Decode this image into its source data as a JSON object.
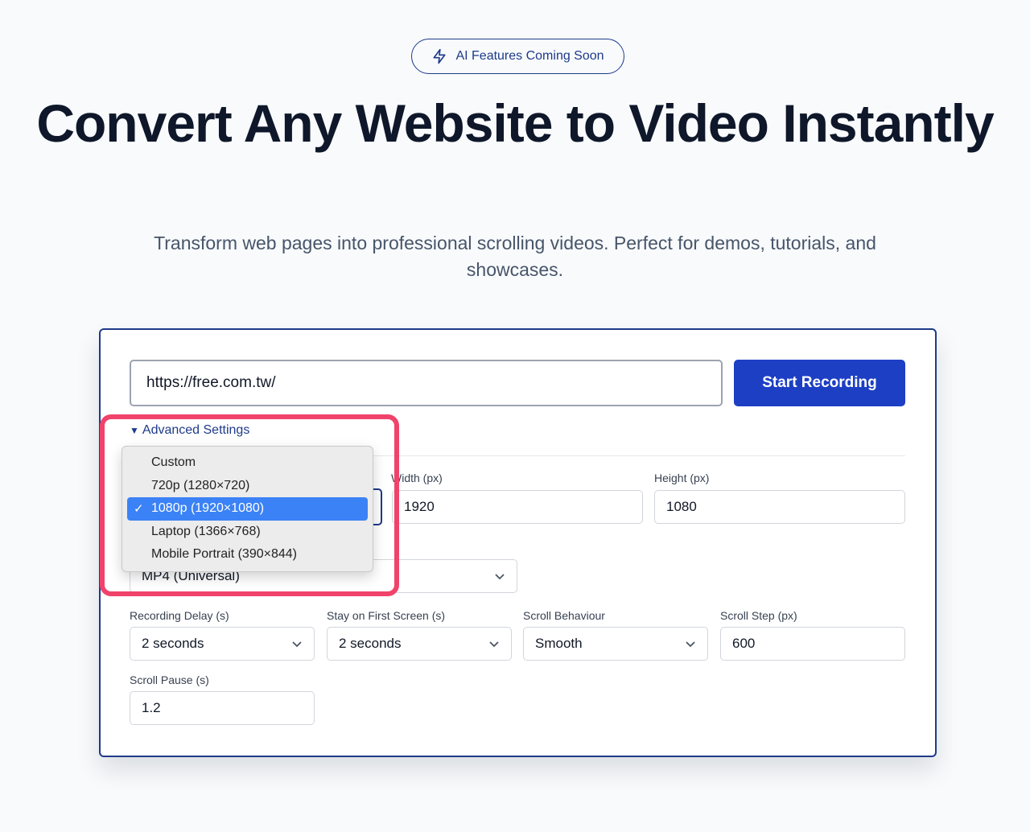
{
  "badge": {
    "icon": "lightning-icon",
    "label": "AI Features Coming Soon"
  },
  "hero": {
    "title": "Convert Any Website to Video Instantly",
    "subtitle": "Transform web pages into professional scrolling videos. Perfect for demos, tutorials, and showcases."
  },
  "form": {
    "url_value": "https://free.com.tw/",
    "start_button": "Start Recording",
    "advanced_toggle": "Advanced Settings",
    "width_label": "Width (px)",
    "width_value": "1920",
    "height_label": "Height (px)",
    "height_value": "1080",
    "format_value": "MP4 (Universal)",
    "recording_delay_label": "Recording Delay (s)",
    "recording_delay_value": "2 seconds",
    "stay_first_label": "Stay on First Screen (s)",
    "stay_first_value": "2 seconds",
    "scroll_behaviour_label": "Scroll Behaviour",
    "scroll_behaviour_value": "Smooth",
    "scroll_step_label": "Scroll Step (px)",
    "scroll_step_value": "600",
    "scroll_pause_label": "Scroll Pause (s)",
    "scroll_pause_value": "1.2"
  },
  "preset_dropdown": {
    "options": [
      {
        "label": "Custom",
        "selected": false
      },
      {
        "label": "720p (1280×720)",
        "selected": false
      },
      {
        "label": "1080p (1920×1080)",
        "selected": true
      },
      {
        "label": "Laptop (1366×768)",
        "selected": false
      },
      {
        "label": "Mobile Portrait (390×844)",
        "selected": false
      }
    ],
    "check_mark": "✓"
  },
  "colors": {
    "accent": "#1d3fc4",
    "navy": "#1e3a8a",
    "highlight": "#f0436b",
    "selected_option": "#3b82f6"
  }
}
